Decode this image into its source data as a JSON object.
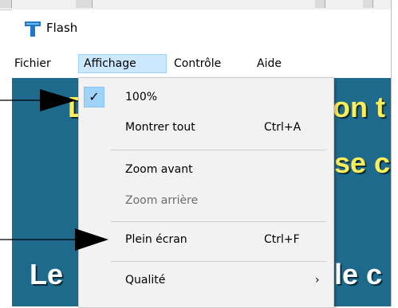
{
  "window": {
    "title": "Flash"
  },
  "menubar": {
    "items": [
      "Fichier",
      "Affichage",
      "Contrôle",
      "Aide"
    ]
  },
  "dropdown": {
    "items": [
      {
        "label": "100%",
        "checked": true
      },
      {
        "label": "Montrer tout",
        "shortcut": "Ctrl+A"
      },
      {
        "label": "Zoom avant"
      },
      {
        "label": "Zoom arrière",
        "disabled": true
      },
      {
        "label": "Plein écran",
        "shortcut": "Ctrl+F"
      },
      {
        "label": "Qualité",
        "submenu": true
      }
    ],
    "check_glyph": "✓",
    "submenu_glyph": "›"
  },
  "content": {
    "fragments": [
      "D",
      "on t",
      "se c",
      "Le",
      "le c"
    ]
  },
  "colors": {
    "content_bg": "#1d6a8c",
    "menu_bg": "#f2f2f2",
    "highlight": "#cce8ff",
    "title_accent": "#ffee55"
  },
  "icons": {
    "app": "flash-t-icon",
    "checkmark": "checkmark-icon",
    "submenu": "chevron-right-icon"
  }
}
